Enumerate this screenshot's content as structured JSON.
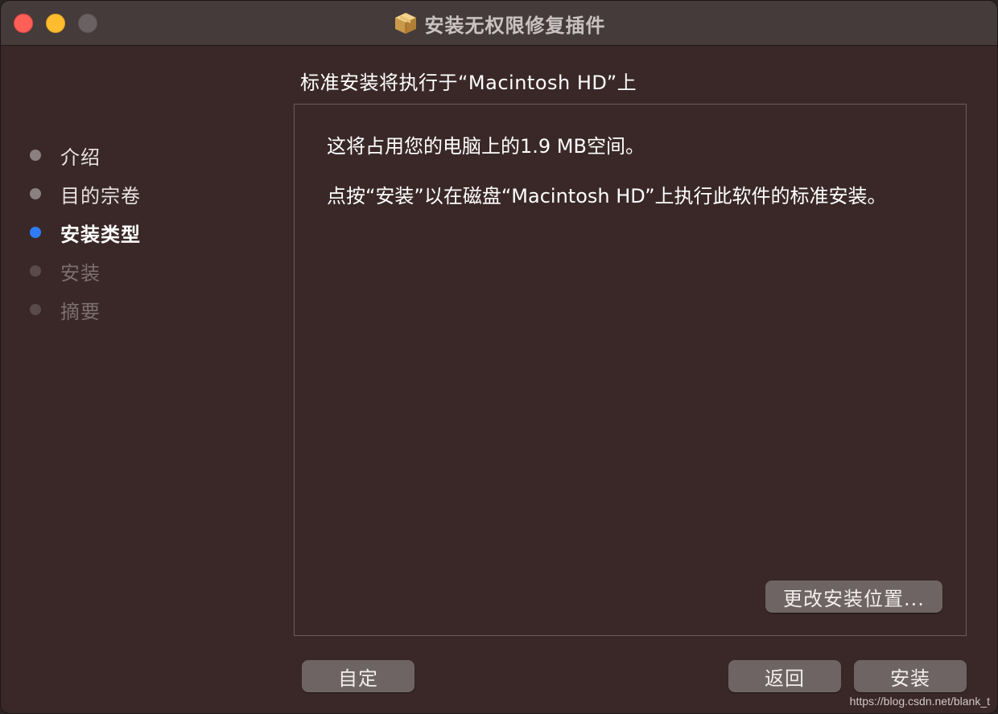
{
  "window": {
    "title": "安装无权限修复插件",
    "title_icon": "package-icon"
  },
  "colors": {
    "window_bg": "#3a2828",
    "titlebar_bg": "#463b3b",
    "accent_current_step": "#2f7bf6",
    "close": "#fe5f57",
    "minimize": "#febc2e",
    "zoom_inactive": "#6a6262",
    "button_bg": "#6f6464"
  },
  "sidebar": {
    "steps": [
      {
        "label": "介绍",
        "state": "done"
      },
      {
        "label": "目的宗卷",
        "state": "done"
      },
      {
        "label": "安装类型",
        "state": "current"
      },
      {
        "label": "安装",
        "state": "pending"
      },
      {
        "label": "摘要",
        "state": "pending"
      }
    ]
  },
  "main": {
    "heading": "标准安装将执行于“Macintosh HD”上",
    "line1": "这将占用您的电脑上的1.9 MB空间。",
    "line2": "点按“安装”以在磁盘“Macintosh HD”上执行此软件的标准安装。",
    "change_location_label": "更改安装位置..."
  },
  "footer": {
    "customize_label": "自定",
    "back_label": "返回",
    "install_label": "安装"
  },
  "watermark": "https://blog.csdn.net/blank_t"
}
